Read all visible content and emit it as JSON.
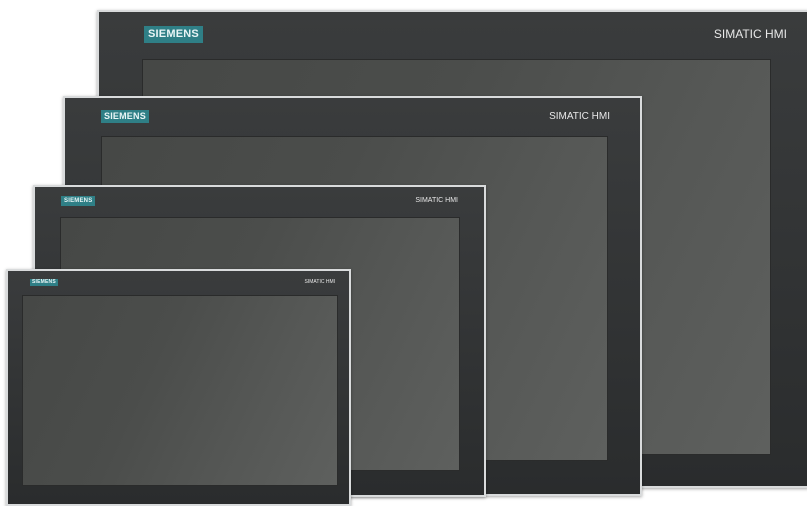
{
  "page_fragment": "e",
  "panels": [
    {
      "brand": "SIEMENS",
      "model": "SIMATIC HMI"
    },
    {
      "brand": "SIEMENS",
      "model": "SIMATIC HMI"
    },
    {
      "brand": "SIEMENS",
      "model": "SIMATIC HMI"
    },
    {
      "brand": "SIEMENS",
      "model": "SIMATIC HMI"
    }
  ],
  "colors": {
    "bezel": "#2f3132",
    "screen": "#4c4e4c",
    "brand_badge": "#2f7f86",
    "frame": "#d9dbdc"
  }
}
